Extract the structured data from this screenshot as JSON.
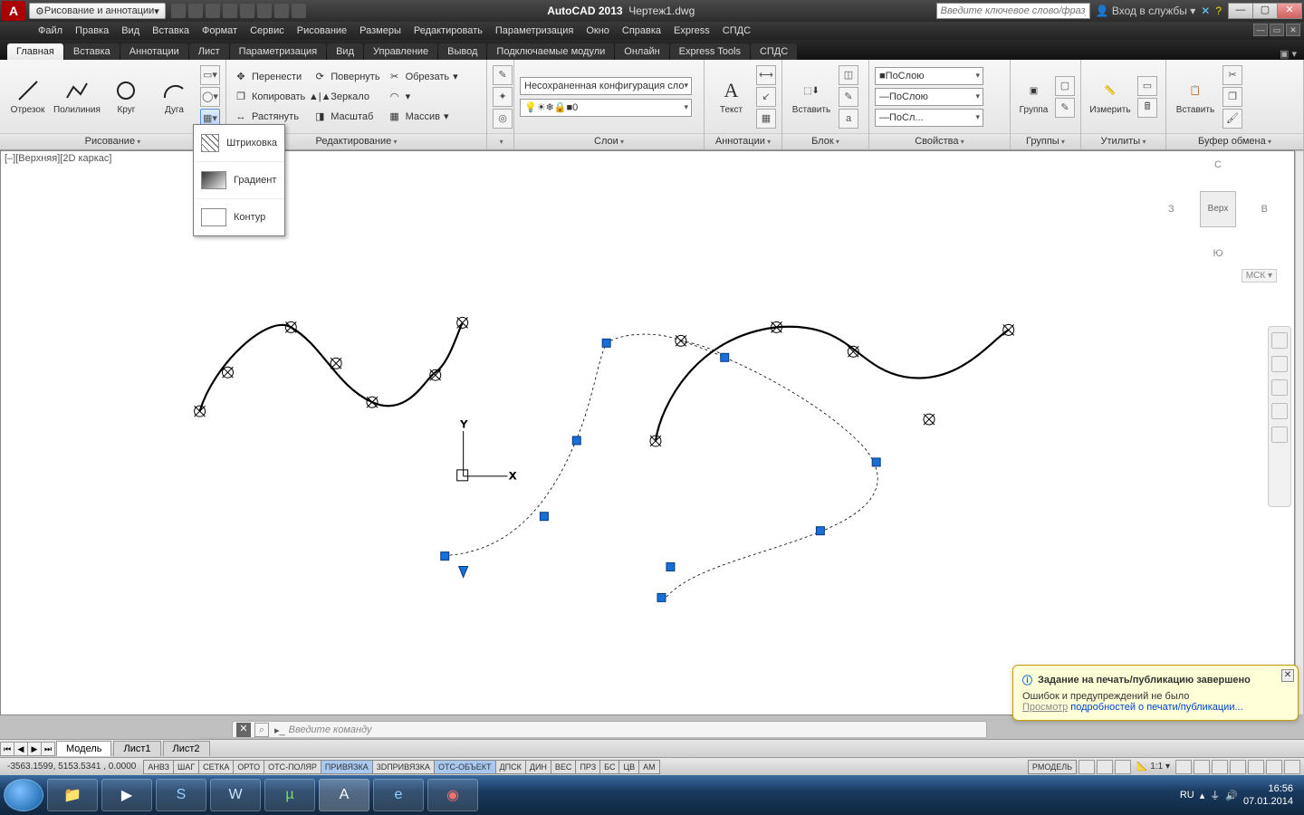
{
  "title": {
    "app": "AutoCAD 2013",
    "doc": "Чертеж1.dwg"
  },
  "workspace": "Рисование и аннотации",
  "search_placeholder": "Введите ключевое слово/фразу",
  "signin": "Вход в службы",
  "menus": [
    "Файл",
    "Правка",
    "Вид",
    "Вставка",
    "Формат",
    "Сервис",
    "Рисование",
    "Размеры",
    "Редактировать",
    "Параметризация",
    "Окно",
    "Справка",
    "Express",
    "СПДС"
  ],
  "tabs": [
    "Главная",
    "Вставка",
    "Аннотации",
    "Лист",
    "Параметризация",
    "Вид",
    "Управление",
    "Вывод",
    "Подключаемые модули",
    "Онлайн",
    "Express Tools",
    "СПДС"
  ],
  "active_tab": 0,
  "panels": {
    "draw": {
      "title": "Рисование",
      "line": "Отрезок",
      "pline": "Полилиния",
      "circle": "Круг",
      "arc": "Дуга"
    },
    "modify": {
      "title": "Редактирование",
      "move": "Перенести",
      "rotate": "Повернуть",
      "trim": "Обрезать",
      "copy": "Копировать",
      "mirror": "Зеркало",
      "stretch": "Растянуть",
      "scale": "Масштаб",
      "array": "Массив"
    },
    "layers": {
      "title": "Слои",
      "unsaved": "Несохраненная конфигурация сло",
      "current": "0"
    },
    "anno": {
      "title": "Аннотации",
      "text": "Текст"
    },
    "block": {
      "title": "Блок",
      "insert": "Вставить"
    },
    "props": {
      "title": "Свойства",
      "bylayer": "ПоСлою",
      "bylayerline": "ПоСлою",
      "bylayerlw": "ПоСл..."
    },
    "groups": {
      "title": "Группы",
      "group": "Группа"
    },
    "utils": {
      "title": "Утилиты",
      "measure": "Измерить"
    },
    "clip": {
      "title": "Буфер обмена",
      "paste": "Вставить"
    }
  },
  "flyout": {
    "hatch": "Штриховка",
    "gradient": "Градиент",
    "boundary": "Контур"
  },
  "viewport_label": "[–][Верхняя][2D каркас]",
  "viewcube": {
    "n": "С",
    "s": "Ю",
    "w": "З",
    "e": "В",
    "top": "Верх",
    "wcs": "МСК ▾"
  },
  "balloon": {
    "title": "Задание на печать/публикацию завершено",
    "msg": "Ошибок и предупреждений не было",
    "link_pre": "Просмотр",
    "link": " подробностей о печати/публикации..."
  },
  "cmd_placeholder": "Введите команду",
  "layout_tabs": [
    "Модель",
    "Лист1",
    "Лист2"
  ],
  "coords": "-3563.1599, 5153.5341 , 0.0000",
  "status_toggles": [
    "АНВЗ",
    "ШАГ",
    "СЕТКА",
    "ОРТО",
    "ОТС-ПОЛЯР",
    "ПРИВЯЗКА",
    "3DПРИВЯЗКА",
    "ОТС-ОБЪЕКТ",
    "ДПСК",
    "ДИН",
    "ВЕС",
    "ПРЗ",
    "БС",
    "ЦВ",
    "АМ"
  ],
  "toggle_on": [
    5,
    7
  ],
  "model_label": "РМОДЕЛЬ",
  "scale": "1:1",
  "tray": {
    "lang": "RU",
    "time": "16:56",
    "date": "07.01.2014"
  }
}
